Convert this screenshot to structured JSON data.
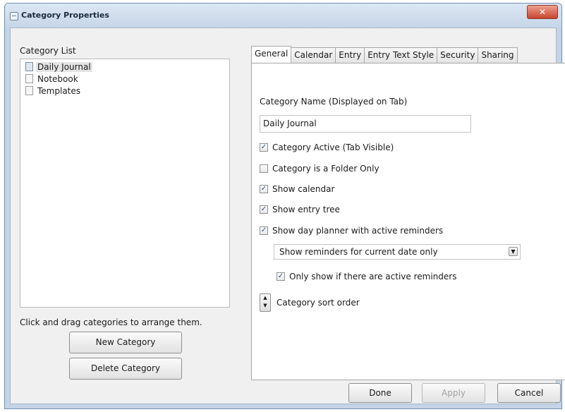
{
  "window": {
    "title": "Category Properties",
    "close_glyph": "✕"
  },
  "category_list": {
    "label": "Category List",
    "items": [
      "Daily Journal",
      "Notebook",
      "Templates"
    ],
    "selected": "Daily Journal"
  },
  "hint": "Click and drag categories to arrange them.",
  "buttons": {
    "new_category": "New Category",
    "delete_category": "Delete Category",
    "done": "Done",
    "apply": "Apply",
    "cancel": "Cancel"
  },
  "tabs": [
    "General",
    "Calendar",
    "Entry",
    "Entry Text Style",
    "Security",
    "Sharing"
  ],
  "active_tab": "General",
  "general": {
    "name_label": "Category Name (Displayed on Tab)",
    "name_value": "Daily Journal",
    "checkboxes": [
      {
        "label": "Category Active (Tab Visible)",
        "checked": true
      },
      {
        "label": "Category is a Folder Only",
        "checked": false
      },
      {
        "label": "Show calendar",
        "checked": true
      },
      {
        "label": "Show entry tree",
        "checked": true
      },
      {
        "label": "Show day planner with active reminders",
        "checked": true
      }
    ],
    "reminder_select": "Show reminders for current date only",
    "only_active": {
      "label": "Only show if there are active reminders",
      "checked": true
    },
    "sort_label": "Category sort order"
  },
  "icons": {
    "check": "✓",
    "dropdown": "▼",
    "spinner_up": "▲",
    "spinner_down": "▼"
  }
}
